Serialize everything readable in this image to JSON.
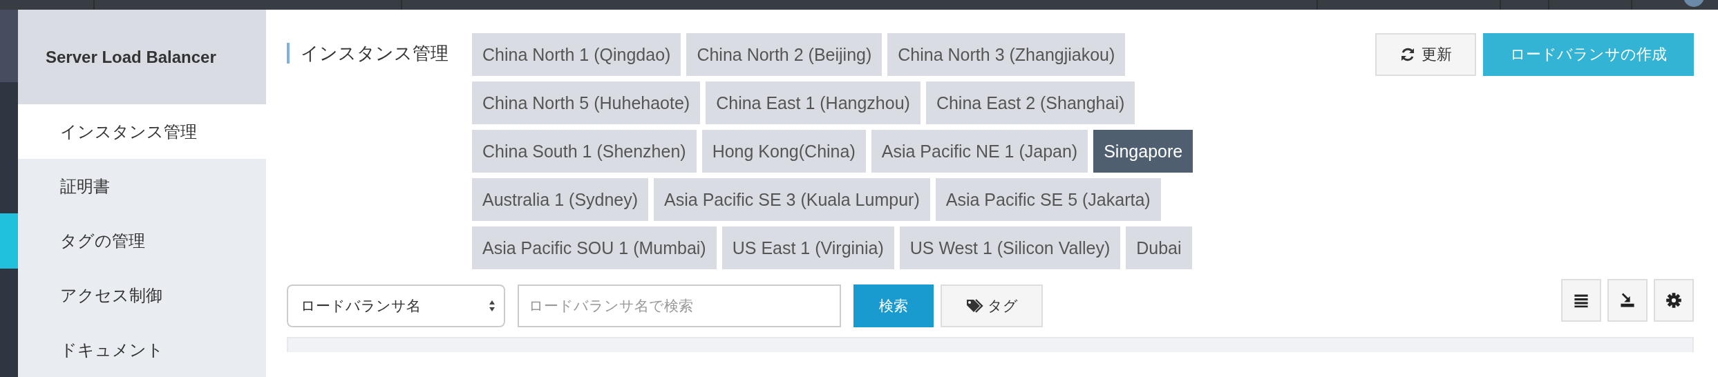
{
  "sidebar": {
    "title": "Server Load Balancer",
    "items": [
      {
        "label": "インスタンス管理",
        "selected": true
      },
      {
        "label": "証明書",
        "selected": false
      },
      {
        "label": "タグの管理",
        "selected": false
      },
      {
        "label": "アクセス制御",
        "selected": false
      },
      {
        "label": "ドキュメント",
        "selected": false
      }
    ]
  },
  "page_title": "インスタンス管理",
  "region_rows": [
    [
      {
        "label": "China North 1 (Qingdao)",
        "selected": false
      },
      {
        "label": "China North 2 (Beijing)",
        "selected": false
      },
      {
        "label": "China North 3 (Zhangjiakou)",
        "selected": false
      }
    ],
    [
      {
        "label": "China North 5 (Huhehaote)",
        "selected": false
      },
      {
        "label": "China East 1 (Hangzhou)",
        "selected": false
      },
      {
        "label": "China East 2 (Shanghai)",
        "selected": false
      }
    ],
    [
      {
        "label": "China South 1 (Shenzhen)",
        "selected": false
      },
      {
        "label": "Hong Kong(China)",
        "selected": false
      },
      {
        "label": "Asia Pacific NE 1 (Japan)",
        "selected": false
      },
      {
        "label": "Singapore",
        "selected": true
      }
    ],
    [
      {
        "label": "Australia 1 (Sydney)",
        "selected": false
      },
      {
        "label": "Asia Pacific SE 3 (Kuala Lumpur)",
        "selected": false
      },
      {
        "label": "Asia Pacific SE 5 (Jakarta)",
        "selected": false
      }
    ],
    [
      {
        "label": "Asia Pacific SOU 1 (Mumbai)",
        "selected": false
      },
      {
        "label": "US East 1 (Virginia)",
        "selected": false
      },
      {
        "label": "US West 1 (Silicon Valley)",
        "selected": false
      },
      {
        "label": "Dubai",
        "selected": false
      }
    ]
  ],
  "refresh_button": "更新",
  "create_button": "ロードバランサの作成",
  "search": {
    "field_select": "ロードバランサ名",
    "placeholder": "ロードバランサ名で検索",
    "search_button": "検索",
    "tag_button": "タグ"
  }
}
